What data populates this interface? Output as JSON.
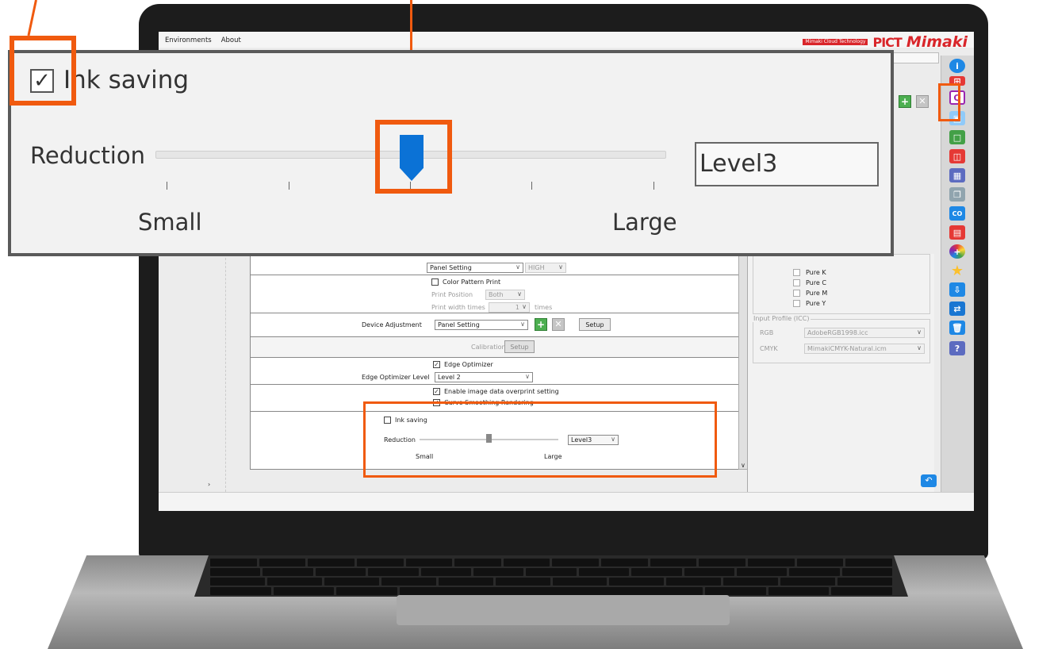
{
  "menu": [
    "Environments",
    "About"
  ],
  "logo": {
    "cloud": "Mimaki Cloud Technology",
    "pict": "PICT",
    "brand": "Mimaki"
  },
  "toolbar_icons": [
    "info-icon",
    "layers-icon",
    "print-queue-icon",
    "image-icon",
    "frame-icon",
    "layout-icon",
    "table-icon",
    "copy-icon",
    "co-icon",
    "document-icon",
    "color-wheel-icon",
    "star-icon",
    "export-icon",
    "transfer-icon",
    "trash-icon",
    "help-icon"
  ],
  "pinch": {
    "select": "Panel Setting",
    "pressure": "HIGH"
  },
  "color_pattern": {
    "label": "Color Pattern Print",
    "position_label": "Print Position",
    "position_value": "Both",
    "width_label": "Print width times",
    "width_value": "1",
    "width_unit": "times"
  },
  "device_adjustment": {
    "label": "Device Adjustment",
    "value": "Panel Setting",
    "setup": "Setup"
  },
  "calibration": {
    "label": "Calibration",
    "setup": "Setup"
  },
  "edge": {
    "optimizer": "Edge Optimizer",
    "level_label": "Edge Optimizer Level",
    "level_value": "Level 2"
  },
  "overprint": "Enable image data overprint setting",
  "curve": "Curve Smoothing Rendering",
  "ink_saving": {
    "label": "Ink saving",
    "reduction_label": "Reduction",
    "small": "Small",
    "large": "Large",
    "level": "Level3",
    "slider_value": 0.5
  },
  "pure_colors": [
    "Pure K",
    "Pure C",
    "Pure M",
    "Pure Y"
  ],
  "input_profile": {
    "title": "Input Profile (ICC)",
    "rgb_label": "RGB",
    "rgb_value": "AdobeRGB1998.icc",
    "cmyk_label": "CMYK",
    "cmyk_value": "MimakiCMYK-Natural.icm"
  },
  "colors": {
    "accent": "#f05a0f",
    "slider": "#0b72d6",
    "brand": "#d9252a"
  }
}
